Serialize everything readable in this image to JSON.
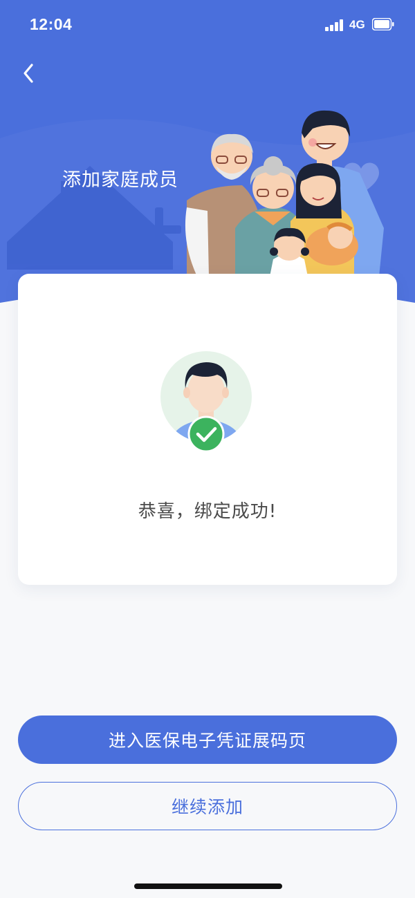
{
  "status_bar": {
    "time": "12:04",
    "network": "4G"
  },
  "header": {
    "title": "添加家庭成员",
    "illustration": "family-illustration"
  },
  "result": {
    "message": "恭喜，绑定成功!",
    "status": "success",
    "icon": "check-icon"
  },
  "actions": {
    "primary_label": "进入医保电子凭证展码页",
    "secondary_label": "继续添加"
  },
  "colors": {
    "brand": "#4a6fdc",
    "success": "#3cb35e",
    "background": "#f7f8fa"
  }
}
